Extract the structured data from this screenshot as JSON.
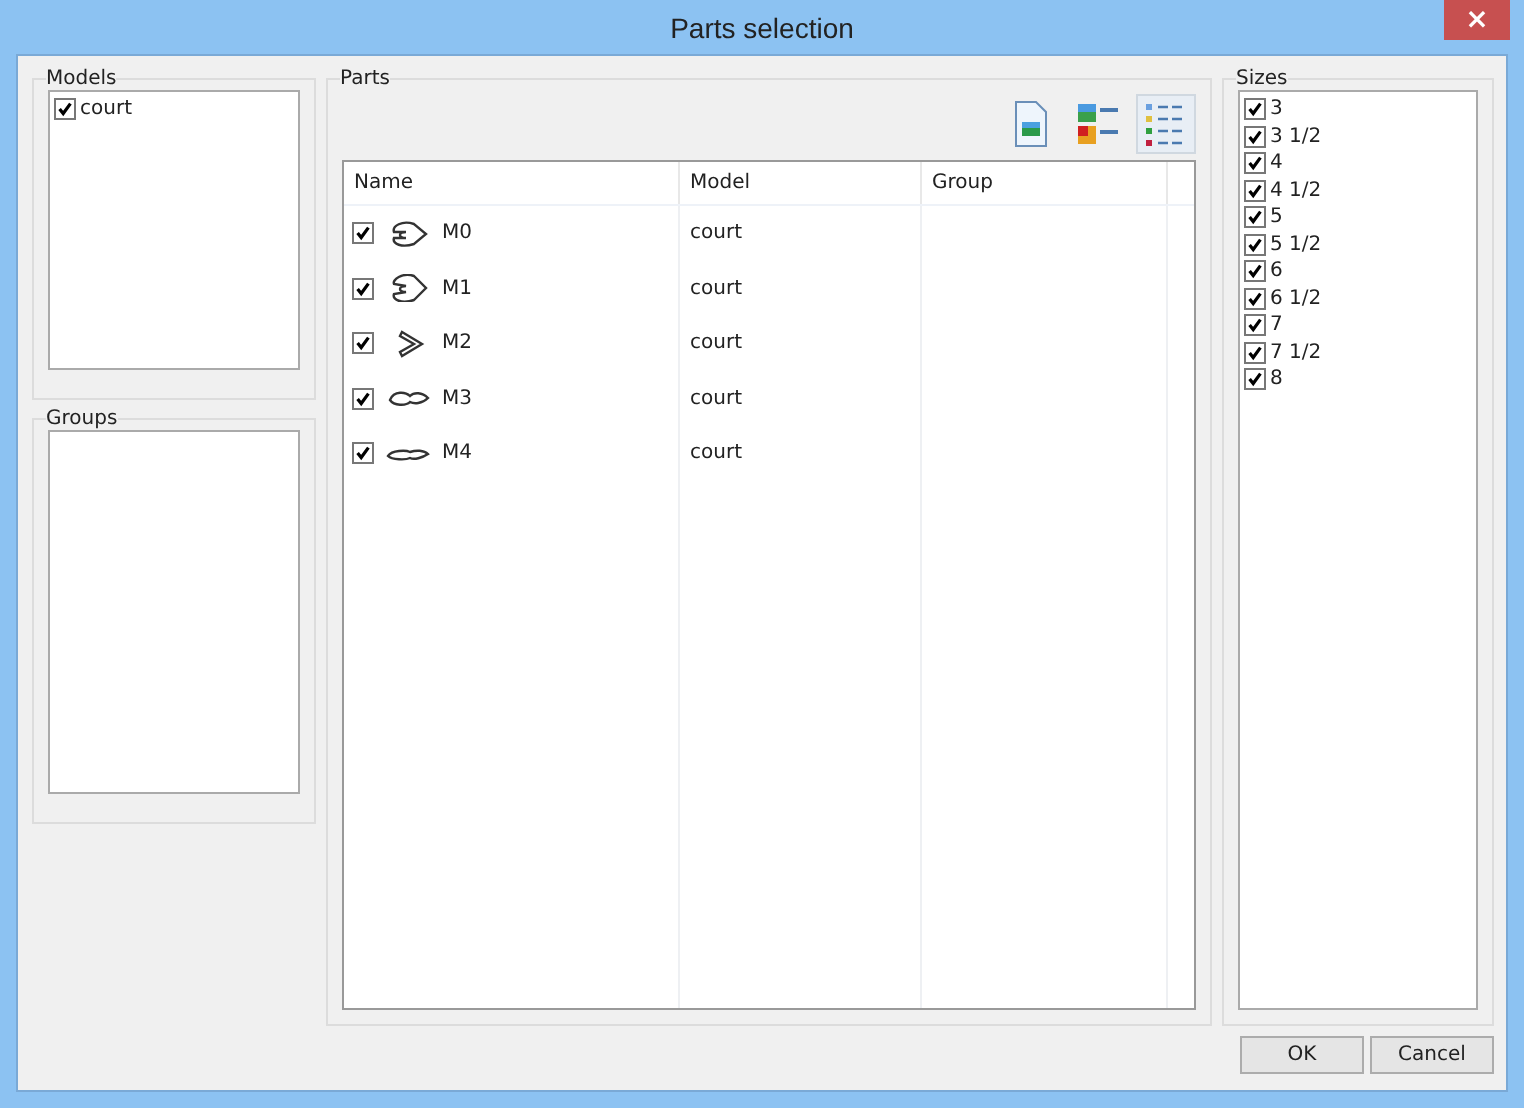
{
  "window": {
    "title": "Parts selection",
    "close": "×"
  },
  "models": {
    "title": "Models",
    "items": [
      {
        "label": "court",
        "checked": true
      }
    ]
  },
  "groups": {
    "title": "Groups"
  },
  "parts": {
    "title": "Parts",
    "views": [
      {
        "kind": "document",
        "selected": false
      },
      {
        "kind": "tiles",
        "selected": false
      },
      {
        "kind": "details",
        "selected": true
      }
    ],
    "columns": [
      "Name",
      "Model",
      "Group"
    ],
    "rows": [
      {
        "name": "M0",
        "model": "court",
        "group": "",
        "checked": true
      },
      {
        "name": "M1",
        "model": "court",
        "group": "",
        "checked": true
      },
      {
        "name": "M2",
        "model": "court",
        "group": "",
        "checked": true
      },
      {
        "name": "M3",
        "model": "court",
        "group": "",
        "checked": true
      },
      {
        "name": "M4",
        "model": "court",
        "group": "",
        "checked": true
      }
    ]
  },
  "sizes": {
    "title": "Sizes",
    "items": [
      {
        "label": "3",
        "checked": true
      },
      {
        "label": "3 1/2",
        "checked": true
      },
      {
        "label": "4",
        "checked": true
      },
      {
        "label": "4 1/2",
        "checked": true
      },
      {
        "label": "5",
        "checked": true
      },
      {
        "label": "5 1/2",
        "checked": true
      },
      {
        "label": "6",
        "checked": true
      },
      {
        "label": "6 1/2",
        "checked": true
      },
      {
        "label": "7",
        "checked": true
      },
      {
        "label": "7 1/2",
        "checked": true
      },
      {
        "label": "8",
        "checked": true
      }
    ]
  },
  "buttons": [
    "OK",
    "Cancel"
  ]
}
